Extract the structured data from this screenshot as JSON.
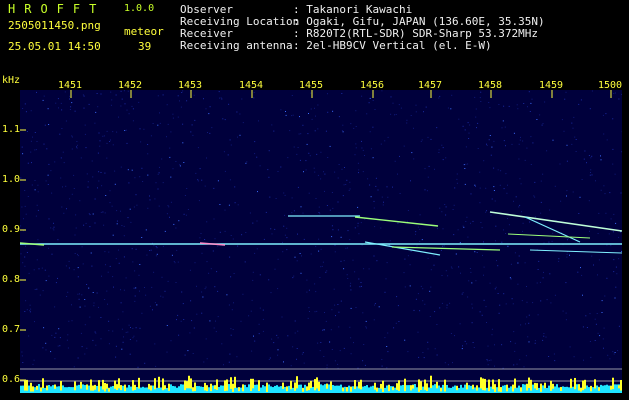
{
  "header": {
    "app_title": "HROFFT",
    "app_version": "1.0.0",
    "file_name": "2505011450.png",
    "timestamp": "25.05.01 14:50",
    "meteor_label": "meteor",
    "meteor_count": "39"
  },
  "info": {
    "observer_label": "Observer",
    "observer_value": ": Takanori Kawachi",
    "location_label": "Receiving Location",
    "location_value": ": Ogaki, Gifu, JAPAN (136.60E, 35.35N)",
    "receiver_label": "Receiver",
    "receiver_value": ": R820T2(RTL-SDR) SDR-Sharp 53.372MHz",
    "antenna_label": "Receiving antenna",
    "antenna_value": ": 2el-HB9CV Vertical (el. E-W)"
  },
  "axis": {
    "unit_label": "kHz",
    "x_ticks": [
      "1451",
      "1452",
      "1453",
      "1454",
      "1455",
      "1456",
      "1457",
      "1458",
      "1459",
      "1500"
    ],
    "y_ticks": [
      "1.1",
      "1.0",
      "0.9",
      "0.8",
      "0.7",
      "0.6"
    ]
  },
  "colors": {
    "background": "#00003c",
    "trace": "#7ff0ff",
    "tick": "#ffff3c",
    "text_green": "#c8ff28"
  }
}
